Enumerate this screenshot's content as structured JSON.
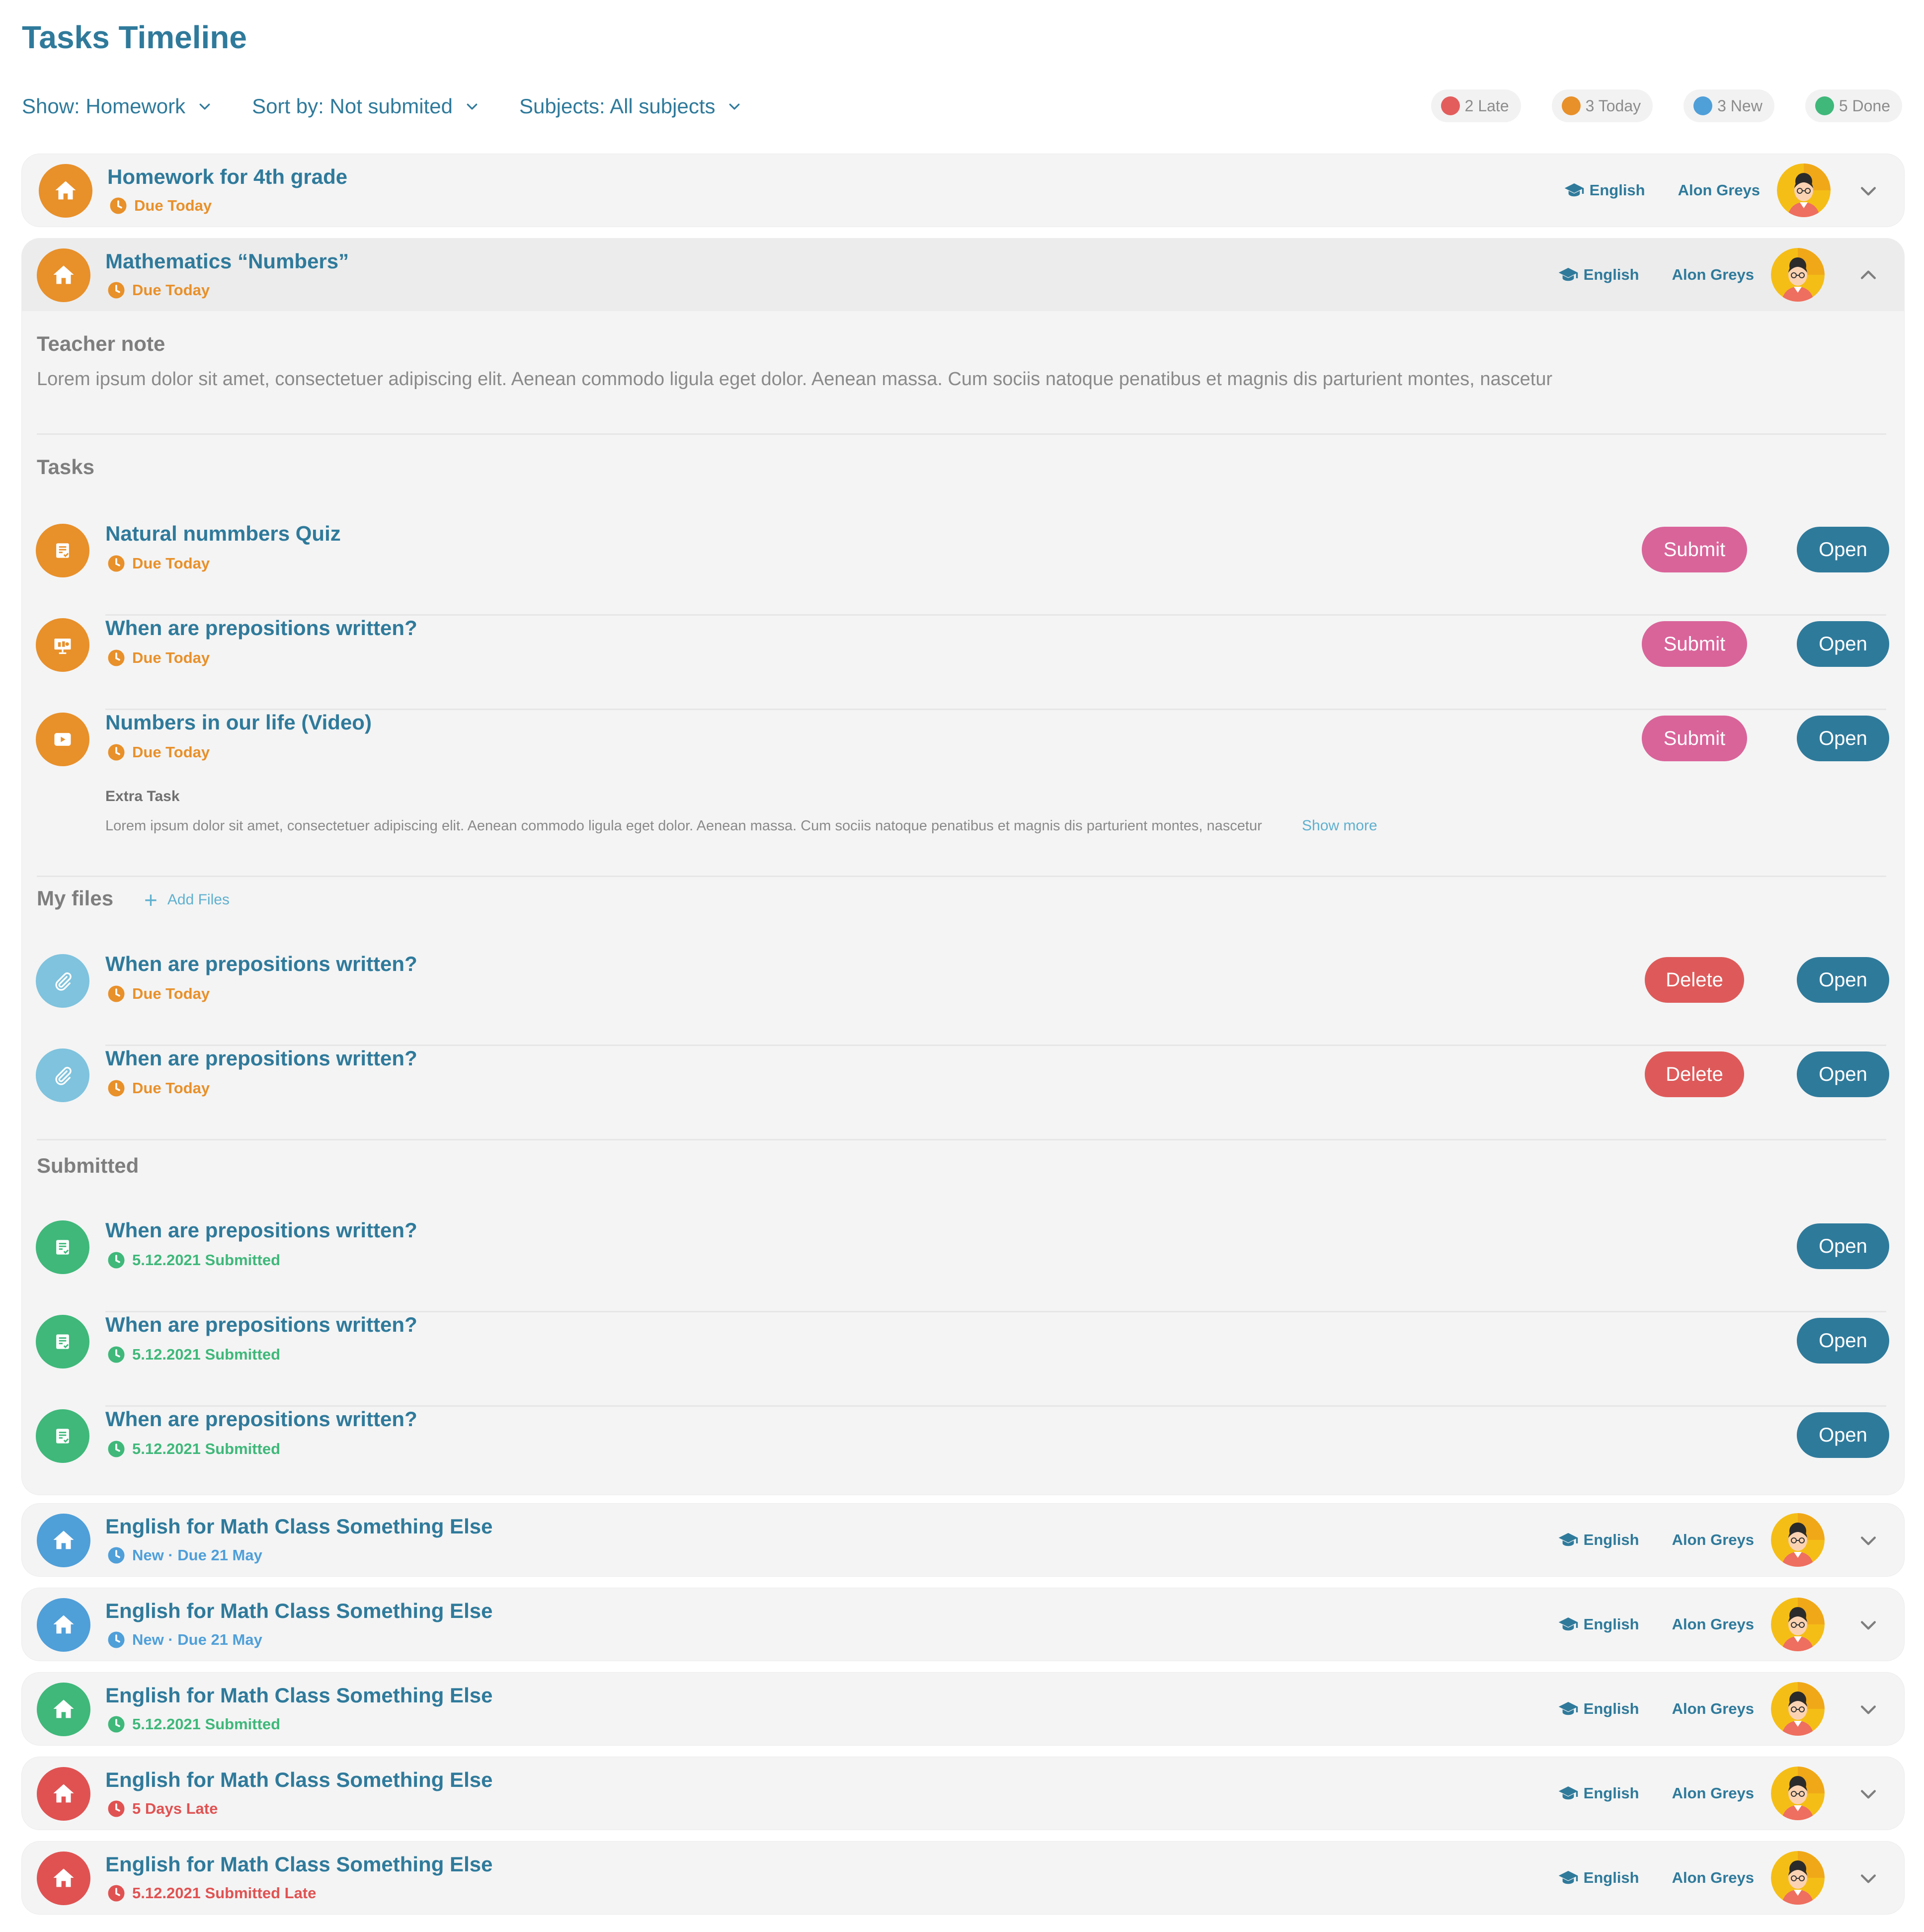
{
  "page": {
    "title": "Tasks Timeline"
  },
  "filters": [
    {
      "label": "Show: Homework"
    },
    {
      "label": "Sort by: Not submited"
    },
    {
      "label": "Subjects: All subjects"
    }
  ],
  "legend": [
    {
      "label": "2 Late",
      "color": "#e35d5d"
    },
    {
      "label": "3 Today",
      "color": "#e8902a"
    },
    {
      "label": "3 New",
      "color": "#4f9fd9"
    },
    {
      "label": "5 Done",
      "color": "#3fb87a"
    }
  ],
  "colors": {
    "primary": "#2f7a9b",
    "orange": "#e8902a",
    "green": "#3fb87a",
    "blue": "#4f9fd9",
    "red": "#e05252",
    "submit": "#d9649a",
    "delete": "#de5a5a",
    "attachment": "#7fc3de"
  },
  "cards": [
    {
      "title": "Homework for 4th grade",
      "status": "Due Today",
      "status_color": "orange",
      "icon": "home-icon",
      "subject": "English",
      "teacher": "Alon Greys",
      "expanded": false
    },
    {
      "title": "Mathematics “Numbers”",
      "status": "Due Today",
      "status_color": "orange",
      "icon": "home-icon",
      "subject": "English",
      "teacher": "Alon Greys",
      "expanded": true
    },
    {
      "title": "English for Math Class Something Else",
      "status": "New · Due 21 May",
      "status_color": "blue",
      "icon": "home-icon",
      "subject": "English",
      "teacher": "Alon Greys",
      "expanded": false
    },
    {
      "title": "English for Math Class Something Else",
      "status": "New · Due 21 May",
      "status_color": "blue",
      "icon": "home-icon",
      "subject": "English",
      "teacher": "Alon Greys",
      "expanded": false
    },
    {
      "title": "English for Math Class Something Else",
      "status": "5.12.2021 Submitted",
      "status_color": "green",
      "icon": "home-icon",
      "subject": "English",
      "teacher": "Alon Greys",
      "expanded": false
    },
    {
      "title": "English for Math Class Something Else",
      "status": "5 Days Late",
      "status_color": "red",
      "icon": "home-icon",
      "subject": "English",
      "teacher": "Alon Greys",
      "expanded": false
    },
    {
      "title": "English for Math Class Something Else",
      "status": "5.12.2021 Submitted Late",
      "status_color": "red",
      "icon": "home-icon",
      "subject": "English",
      "teacher": "Alon Greys",
      "expanded": false
    }
  ],
  "details": {
    "teacher_note": {
      "heading": "Teacher note",
      "text": "Lorem ipsum dolor sit amet, consectetuer adipiscing elit. Aenean commodo ligula eget dolor. Aenean massa. Cum sociis natoque penatibus et magnis dis parturient montes, nascetur"
    },
    "tasks": {
      "heading": "Tasks",
      "items": [
        {
          "title": "Natural nummbers Quiz",
          "status": "Due Today",
          "icon": "quiz-icon",
          "submit_label": "Submit",
          "open_label": "Open"
        },
        {
          "title": "When are prepositions written?",
          "status": "Due Today",
          "icon": "presentation-icon",
          "submit_label": "Submit",
          "open_label": "Open"
        },
        {
          "title": "Numbers in our life (Video)",
          "status": "Due Today",
          "icon": "video-icon",
          "submit_label": "Submit",
          "open_label": "Open"
        }
      ],
      "extra": {
        "label": "Extra Task",
        "text": "Lorem ipsum dolor sit amet, consectetuer adipiscing elit. Aenean commodo ligula eget dolor. Aenean massa. Cum sociis natoque penatibus et magnis dis parturient montes, nascetur",
        "show_more": "Show more"
      }
    },
    "files": {
      "heading": "My files",
      "add_label": "Add Files",
      "items": [
        {
          "title": "When are prepositions written?",
          "status": "Due Today",
          "icon": "paperclip-icon",
          "delete_label": "Delete",
          "open_label": "Open"
        },
        {
          "title": "When are prepositions written?",
          "status": "Due Today",
          "icon": "paperclip-icon",
          "delete_label": "Delete",
          "open_label": "Open"
        }
      ]
    },
    "submitted": {
      "heading": "Submitted",
      "items": [
        {
          "title": "When are prepositions written?",
          "status": "5.12.2021 Submitted",
          "icon": "quiz-icon",
          "open_label": "Open"
        },
        {
          "title": "When are prepositions written?",
          "status": "5.12.2021 Submitted",
          "icon": "quiz-icon",
          "open_label": "Open"
        },
        {
          "title": "When are prepositions written?",
          "status": "5.12.2021 Submitted",
          "icon": "quiz-icon",
          "open_label": "Open"
        }
      ]
    }
  }
}
